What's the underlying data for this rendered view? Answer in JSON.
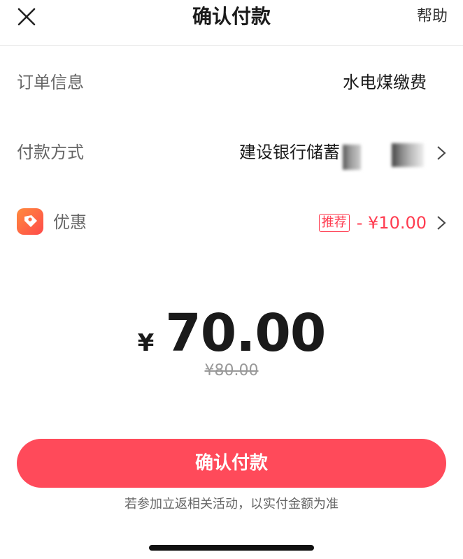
{
  "header": {
    "title": "确认付款",
    "help_label": "帮助",
    "close_icon": "close-icon"
  },
  "order": {
    "label": "订单信息",
    "value": "水电煤缴费"
  },
  "payment_method": {
    "label": "付款方式",
    "value": "建设银行储蓄"
  },
  "discount": {
    "label": "优惠",
    "badge": "推荐",
    "amount": "- ¥10.00",
    "icon": "coupon-tag-icon"
  },
  "amount": {
    "currency": "¥",
    "value": "70.00",
    "original": "¥80.00"
  },
  "confirm_button": {
    "label": "确认付款"
  },
  "footnote": "若参加立返相关活动，以实付金额为准",
  "colors": {
    "accent": "#ff4a5a",
    "discount": "#ff3b4f",
    "muted": "#999999"
  }
}
